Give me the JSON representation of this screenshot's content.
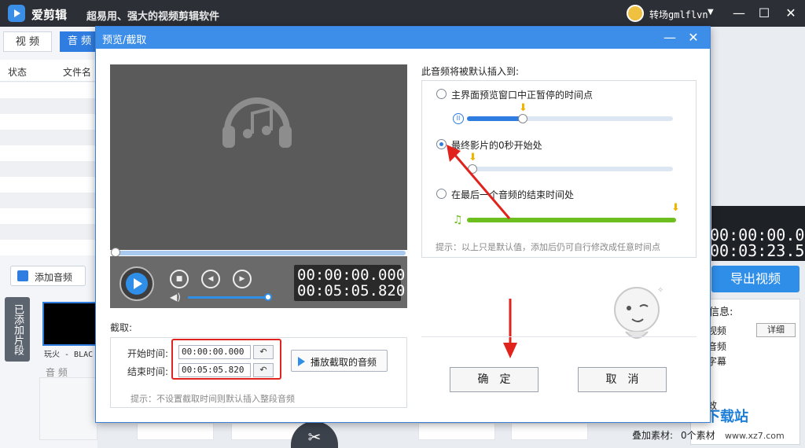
{
  "app": {
    "name": "爱剪辑",
    "slogan": "超易用、强大的视频剪辑软件",
    "user_name": "转场gmlflvn",
    "user_menu_icon": "chevron-down-icon",
    "window_controls": {
      "minimize": "—",
      "maximize": "☐",
      "close": "✕"
    }
  },
  "left_panel": {
    "tabs": [
      {
        "label": "视 频",
        "active": false
      },
      {
        "label": "音 频",
        "active": true
      }
    ],
    "columns": {
      "status": "状态",
      "filename": "文件名"
    },
    "add_audio_button": "添加音频",
    "clips_side_label": "已添加片段",
    "clip_label": "玩火 - BLAC",
    "clip_audio_label": "音 频"
  },
  "right_panel": {
    "time_1": "00:00:00.000",
    "time_2": "00:03:23.520",
    "export_button": "导出视频",
    "info_title": "件的信息:",
    "info_video": "视频",
    "detail_button": "详细",
    "info_audio": "音频",
    "info_subtitle": "字幕",
    "info_effect": "效",
    "overlay_label": "叠加素材:",
    "overlay_value": "0个素材"
  },
  "watermark": {
    "text": "极光下载站",
    "url": "www.xz7.com"
  },
  "timeline": {
    "scissors_icon": "✂"
  },
  "dialog": {
    "title": "预览/截取",
    "minimize_icon": "—",
    "close_icon": "✕",
    "player": {
      "music_icon": "headphones-music-icon",
      "time_current": "00:00:00.000",
      "time_total": "00:05:05.820",
      "progress": 0,
      "volume": 0.85
    },
    "trim": {
      "title": "截取:",
      "start_label": "开始时间:",
      "end_label": "结束时间:",
      "start_value": "00:00:00.000",
      "end_value": "00:05:05.820",
      "play_button": "播放截取的音频",
      "hint": "提示：不设置截取时间则默认插入整段音频"
    },
    "insert": {
      "title": "此音频将被默认插入到:",
      "options": [
        {
          "label": "主界面预览窗口中正暂停的时间点",
          "selected": false
        },
        {
          "label": "最终影片的0秒开始处",
          "selected": true
        },
        {
          "label": "在最后一个音频的结束时间处",
          "selected": false
        }
      ],
      "hint": "提示：以上只是默认值，添加后仍可自行修改成任意时间点"
    },
    "ok_button": "确定",
    "cancel_button": "取消"
  },
  "colors": {
    "accent": "#2f8ee8",
    "titlebar": "#2c2f36",
    "highlight_red": "#e0231c",
    "marker_yellow": "#f0b400",
    "green_bar": "#6cbf1f"
  }
}
